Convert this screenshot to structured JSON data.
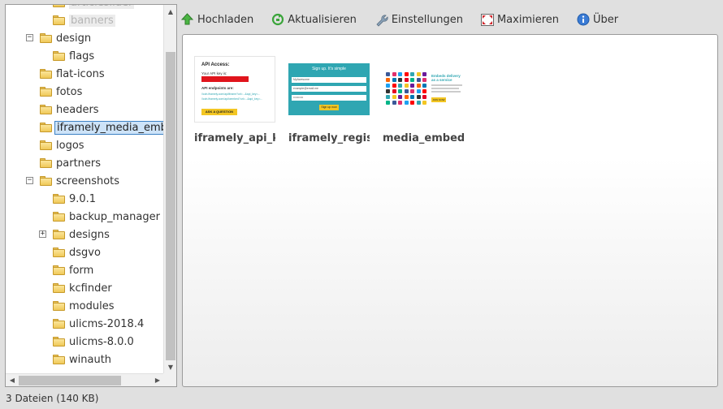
{
  "tree": {
    "items": [
      {
        "label": "articleslider",
        "level": 1,
        "toggle": null,
        "state": "ghost"
      },
      {
        "label": "banners",
        "level": 1,
        "toggle": null,
        "state": "ghost"
      },
      {
        "label": "design",
        "level": 0,
        "toggle": "−",
        "state": ""
      },
      {
        "label": "flags",
        "level": 1,
        "toggle": null,
        "state": ""
      },
      {
        "label": "flat-icons",
        "level": 0,
        "toggle": null,
        "state": ""
      },
      {
        "label": "fotos",
        "level": 0,
        "toggle": null,
        "state": ""
      },
      {
        "label": "headers",
        "level": 0,
        "toggle": null,
        "state": ""
      },
      {
        "label": "iframely_media_embed",
        "level": 0,
        "toggle": null,
        "state": "selected"
      },
      {
        "label": "logos",
        "level": 0,
        "toggle": null,
        "state": ""
      },
      {
        "label": "partners",
        "level": 0,
        "toggle": null,
        "state": ""
      },
      {
        "label": "screenshots",
        "level": 0,
        "toggle": "−",
        "state": ""
      },
      {
        "label": "9.0.1",
        "level": 1,
        "toggle": null,
        "state": ""
      },
      {
        "label": "backup_manager",
        "level": 1,
        "toggle": null,
        "state": ""
      },
      {
        "label": "designs",
        "level": 1,
        "toggle": "+",
        "state": ""
      },
      {
        "label": "dsgvo",
        "level": 1,
        "toggle": null,
        "state": ""
      },
      {
        "label": "form",
        "level": 1,
        "toggle": null,
        "state": ""
      },
      {
        "label": "kcfinder",
        "level": 1,
        "toggle": null,
        "state": ""
      },
      {
        "label": "modules",
        "level": 1,
        "toggle": null,
        "state": ""
      },
      {
        "label": "ulicms-2018.4",
        "level": 1,
        "toggle": null,
        "state": ""
      },
      {
        "label": "ulicms-8.0.0",
        "level": 1,
        "toggle": null,
        "state": ""
      },
      {
        "label": "winauth",
        "level": 1,
        "toggle": null,
        "state": ""
      }
    ]
  },
  "toolbar": {
    "upload": "Hochladen",
    "refresh": "Aktualisieren",
    "settings": "Einstellungen",
    "maximize": "Maximieren",
    "about": "Über"
  },
  "files": [
    {
      "name": "iframely_api_key",
      "thumb": {
        "heading": "API Access:",
        "key_label": "Your API key is:",
        "endpoints_label": "API endpoints are:",
        "link1": "//cdn.iframely.com/api/iframe?url=...&api_key=...",
        "link2": "//cdn.iframely.com/api/oembed?url=...&api_key=...",
        "button": "ASK A QUESTION"
      }
    },
    {
      "name": "iframely_register",
      "thumb": {
        "heading": "Sign up. It's simple",
        "field1": "MyAwesome",
        "field2": "example@email.me",
        "field3": "••••••••••",
        "button": "Sign up now"
      }
    },
    {
      "name": "media_embed_service",
      "thumb": {
        "heading": "Embeds delivery as a service",
        "button": "JOIN NOW"
      }
    }
  ],
  "status": "3 Dateien (140 KB)",
  "colors": {
    "selected_bg": "#cde3f8",
    "selected_border": "#3d82c4",
    "folder": "#f0c959",
    "teal": "#2fa6b2",
    "accent_yellow": "#f3c623",
    "key_red": "#e0141c"
  }
}
